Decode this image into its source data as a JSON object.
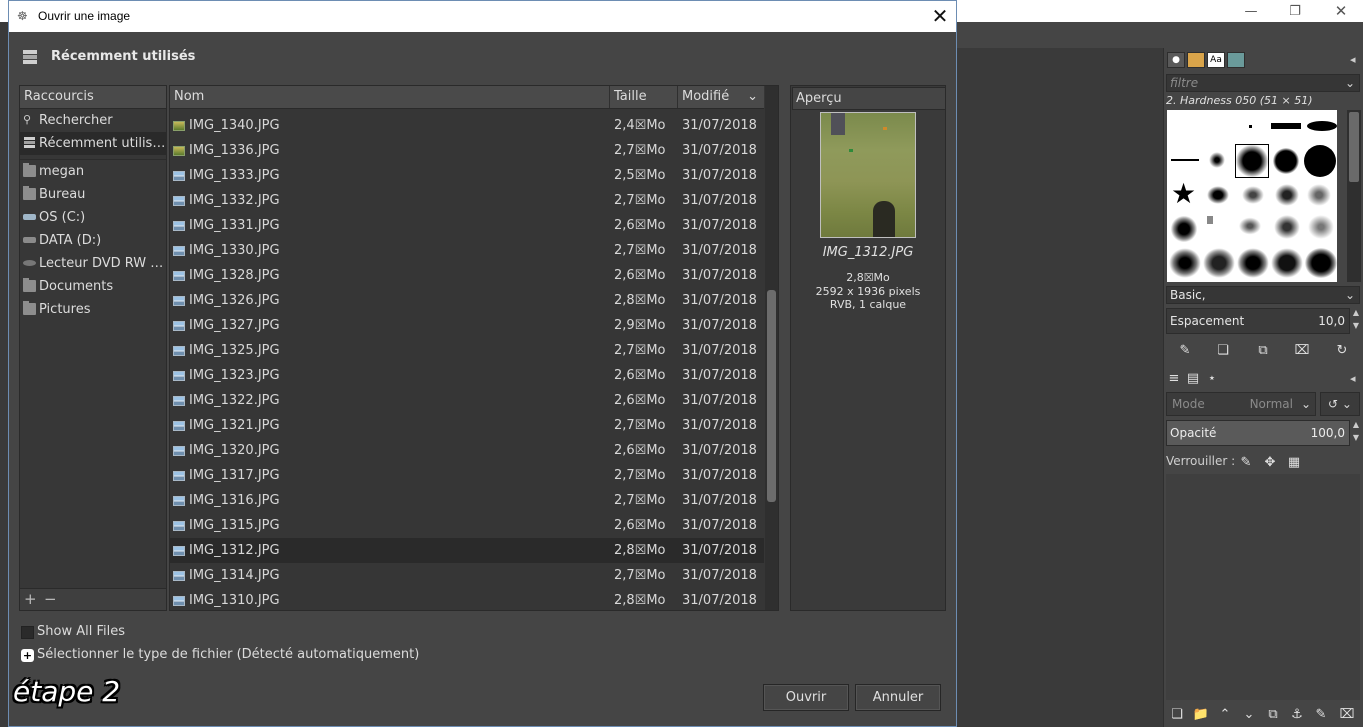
{
  "background_window": {
    "controls": [
      "minimize-icon",
      "restore-icon",
      "close-icon"
    ],
    "dock": {
      "filter_placeholder": "filtre",
      "brush_title": "2. Hardness 050 (51 × 51)",
      "brush_preset": "Basic,",
      "spacing_label": "Espacement",
      "spacing_value": "10,0",
      "mode_label": "Mode",
      "mode_value": "Normal",
      "opacity_label": "Opacité",
      "opacity_value": "100,0",
      "lock_label": "Verrouiller :"
    }
  },
  "dialog": {
    "title": "Ouvrir une image",
    "location": "Récemment utilisés",
    "shortcuts": {
      "header": "Raccourcis",
      "items": [
        {
          "label": "Rechercher",
          "icon": "search-icon"
        },
        {
          "label": "Récemment utilisés",
          "icon": "recent-icon"
        },
        {
          "label": "megan",
          "icon": "folder-icon"
        },
        {
          "label": "Bureau",
          "icon": "folder-icon"
        },
        {
          "label": "OS (C:)",
          "icon": "drive-icon"
        },
        {
          "label": "DATA (D:)",
          "icon": "drive-icon"
        },
        {
          "label": "Lecteur DVD RW (E:)",
          "icon": "dvd-icon"
        },
        {
          "label": "Documents",
          "icon": "folder-icon"
        },
        {
          "label": "Pictures",
          "icon": "folder-icon"
        }
      ]
    },
    "files": {
      "columns": {
        "name": "Nom",
        "size": "Taille",
        "modified": "Modifié"
      },
      "rows": [
        {
          "name": "IMG_1340.JPG",
          "size": "2,4☒Mo",
          "date": "31/07/2018",
          "thumb": true
        },
        {
          "name": "IMG_1336.JPG",
          "size": "2,7☒Mo",
          "date": "31/07/2018",
          "thumb": true
        },
        {
          "name": "IMG_1333.JPG",
          "size": "2,5☒Mo",
          "date": "31/07/2018"
        },
        {
          "name": "IMG_1332.JPG",
          "size": "2,7☒Mo",
          "date": "31/07/2018"
        },
        {
          "name": "IMG_1331.JPG",
          "size": "2,6☒Mo",
          "date": "31/07/2018"
        },
        {
          "name": "IMG_1330.JPG",
          "size": "2,7☒Mo",
          "date": "31/07/2018"
        },
        {
          "name": "IMG_1328.JPG",
          "size": "2,6☒Mo",
          "date": "31/07/2018"
        },
        {
          "name": "IMG_1326.JPG",
          "size": "2,8☒Mo",
          "date": "31/07/2018"
        },
        {
          "name": "IMG_1327.JPG",
          "size": "2,9☒Mo",
          "date": "31/07/2018"
        },
        {
          "name": "IMG_1325.JPG",
          "size": "2,7☒Mo",
          "date": "31/07/2018"
        },
        {
          "name": "IMG_1323.JPG",
          "size": "2,6☒Mo",
          "date": "31/07/2018"
        },
        {
          "name": "IMG_1322.JPG",
          "size": "2,6☒Mo",
          "date": "31/07/2018"
        },
        {
          "name": "IMG_1321.JPG",
          "size": "2,7☒Mo",
          "date": "31/07/2018"
        },
        {
          "name": "IMG_1320.JPG",
          "size": "2,6☒Mo",
          "date": "31/07/2018"
        },
        {
          "name": "IMG_1317.JPG",
          "size": "2,7☒Mo",
          "date": "31/07/2018"
        },
        {
          "name": "IMG_1316.JPG",
          "size": "2,7☒Mo",
          "date": "31/07/2018"
        },
        {
          "name": "IMG_1315.JPG",
          "size": "2,6☒Mo",
          "date": "31/07/2018"
        },
        {
          "name": "IMG_1312.JPG",
          "size": "2,8☒Mo",
          "date": "31/07/2018",
          "selected": true
        },
        {
          "name": "IMG_1314.JPG",
          "size": "2,7☒Mo",
          "date": "31/07/2018"
        },
        {
          "name": "IMG_1310.JPG",
          "size": "2,8☒Mo",
          "date": "31/07/2018"
        }
      ]
    },
    "preview": {
      "header": "Aperçu",
      "name": "IMG_1312.JPG",
      "size": "2,8☒Mo",
      "dimensions": "2592 x 1936 pixels",
      "mode": "RVB, 1 calque"
    },
    "show_all_files": "Show All Files",
    "file_type": "Sélectionner le type de fichier (Détecté automatiquement)",
    "open_label": "Ouvrir",
    "cancel_label": "Annuler"
  },
  "caption": "étape 2"
}
